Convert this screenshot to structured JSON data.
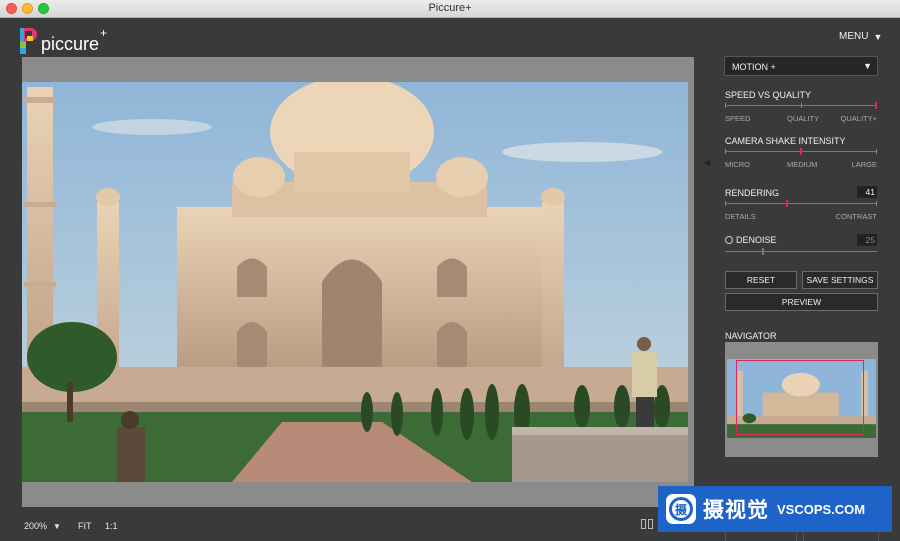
{
  "window": {
    "title": "Piccure+"
  },
  "logo": {
    "text": "piccure",
    "plus": "+"
  },
  "menu": {
    "label": "MENU",
    "icon": "chevron-down-icon"
  },
  "panel": {
    "mode_select": {
      "value": "MOTION +"
    },
    "speed_vs_quality": {
      "title": "SPEED VS QUALITY",
      "labels": [
        "SPEED",
        "QUALITY",
        "QUALITY+"
      ],
      "value_fraction": 1.0
    },
    "camera_shake": {
      "title": "CAMERA SHAKE INTENSITY",
      "labels": [
        "MICRO",
        "MEDIUM",
        "LARGE"
      ],
      "value_fraction": 0.5
    },
    "rendering": {
      "title": "RENDERING",
      "value": "41",
      "labels": [
        "DETAILS",
        "CONTRAST"
      ],
      "value_fraction": 0.41
    },
    "denoise": {
      "label": "DENOISE",
      "value": "25",
      "enabled": false,
      "value_fraction": 0.25
    },
    "buttons": {
      "reset": "RESET",
      "save_settings": "SAVE SETTINGS",
      "preview": "PREVIEW"
    },
    "navigator": {
      "title": "NAVIGATOR"
    }
  },
  "bottom_bar": {
    "zoom": "200%",
    "fit": "FIT",
    "one_to_one": "1:1"
  },
  "colors": {
    "accent": "#e0245e",
    "panel_bg": "#3a3a3a",
    "canvas_bg": "#8b8b8b"
  },
  "watermark": {
    "text_cn": "摄视觉",
    "text_en": "VSCOPS.COM",
    "badge_glyph": "摄"
  }
}
